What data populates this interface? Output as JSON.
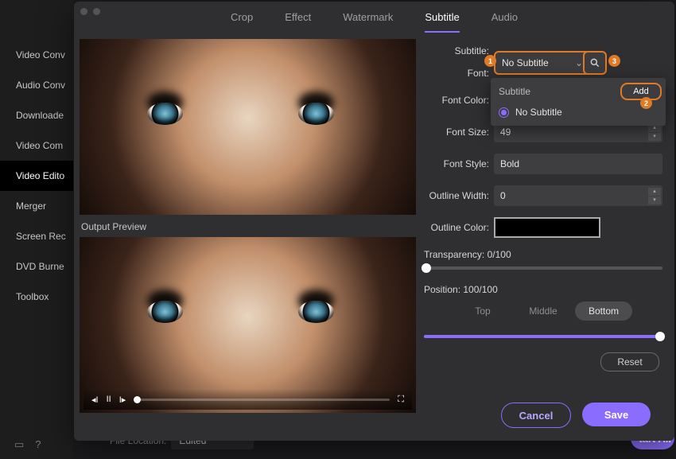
{
  "sidebar": {
    "items": [
      {
        "label": "Video Conv"
      },
      {
        "label": "Audio Conv"
      },
      {
        "label": "Downloade"
      },
      {
        "label": "Video Com"
      },
      {
        "label": "Video Edito"
      },
      {
        "label": "Merger"
      },
      {
        "label": "Screen Rec"
      },
      {
        "label": "DVD Burne"
      },
      {
        "label": "Toolbox"
      }
    ],
    "active": 4
  },
  "tabs": {
    "items": [
      "Crop",
      "Effect",
      "Watermark",
      "Subtitle",
      "Audio"
    ],
    "active": 3
  },
  "preview": {
    "output_label": "Output Preview"
  },
  "subtitle": {
    "label": "Subtitle:",
    "selected": "No Subtitle",
    "dropdown_title": "Subtitle",
    "dropdown_options": [
      "No Subtitle"
    ],
    "add_label": "Add"
  },
  "font": {
    "label": "Font:",
    "value": "",
    "color_label": "Font Color:",
    "color": "#ffffff",
    "size_label": "Font Size:",
    "size": "49",
    "style_label": "Font Style:",
    "style": "Bold"
  },
  "outline": {
    "width_label": "Outline Width:",
    "width": "0",
    "color_label": "Outline Color:",
    "color": "#000000"
  },
  "transparency": {
    "label": "Transparency: 0/100",
    "value_pct": 0
  },
  "position": {
    "label": "Position: 100/100",
    "tabs": [
      "Top",
      "Middle",
      "Bottom"
    ],
    "active": 2,
    "value_pct": 100
  },
  "reset_label": "Reset",
  "actions": {
    "cancel": "Cancel",
    "save": "Save"
  },
  "footer": {
    "file_location_label": "File Location:",
    "file_location_value": "Edited",
    "start_all": "tart All"
  },
  "annotations": {
    "a1": "1",
    "a2": "2",
    "a3": "3"
  }
}
